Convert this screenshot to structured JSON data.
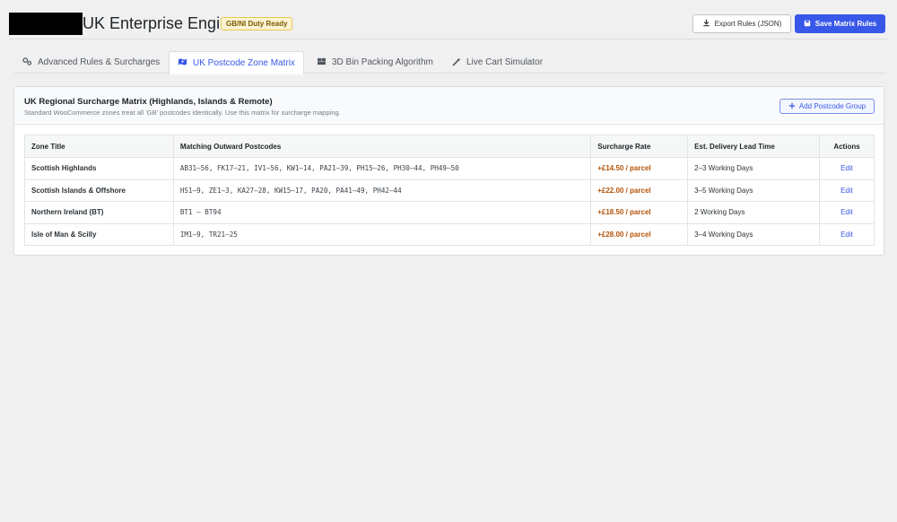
{
  "header": {
    "title": "UK Enterprise Engine",
    "badge": "GB/NI Duty Ready",
    "export_label": "Export Rules (JSON)",
    "save_label": "Save Matrix Rules"
  },
  "tabs": [
    {
      "label": "Advanced Rules & Surcharges",
      "icon": "gears-icon",
      "active": false
    },
    {
      "label": "UK Postcode Zone Matrix",
      "icon": "map-icon",
      "active": true
    },
    {
      "label": "3D Bin Packing Algorithm",
      "icon": "boxes-icon",
      "active": false
    },
    {
      "label": "Live Cart Simulator",
      "icon": "wand-icon",
      "active": false
    }
  ],
  "panel": {
    "title": "UK Regional Surcharge Matrix (Highlands, Islands & Remote)",
    "subtitle": "Standard WooCommerce zones treat all 'GB' postcodes identically. Use this matrix for surcharge mapping.",
    "add_label": "Add Postcode Group"
  },
  "table": {
    "columns": [
      "Zone Title",
      "Matching Outward Postcodes",
      "Surcharge Rate",
      "Est. Delivery Lead Time",
      "Actions"
    ],
    "rows": [
      {
        "zone": "Scottish Highlands",
        "postcodes": "AB31–56, FK17–21, IV1–56, KW1–14, PA21–39, PH15–26, PH30–44, PH49–50",
        "rate": "+£14.50 / parcel",
        "lead": "2–3 Working Days",
        "action": "Edit"
      },
      {
        "zone": "Scottish Islands & Offshore",
        "postcodes": "HS1–9, ZE1–3, KA27–28, KW15–17, PA20, PA41–49, PH42–44",
        "rate": "+£22.00 / parcel",
        "lead": "3–5 Working Days",
        "action": "Edit"
      },
      {
        "zone": "Northern Ireland (BT)",
        "postcodes": "BT1 – BT94",
        "rate": "+£18.50 / parcel",
        "lead": "2 Working Days",
        "action": "Edit"
      },
      {
        "zone": "Isle of Man & Scilly",
        "postcodes": "IM1–9, TR21–25",
        "rate": "+£28.00 / parcel",
        "lead": "3–4 Working Days",
        "action": "Edit"
      }
    ]
  },
  "colors": {
    "accent": "#3858e9",
    "surcharge": "#b45309",
    "badge_bg": "#fcf3d1"
  }
}
